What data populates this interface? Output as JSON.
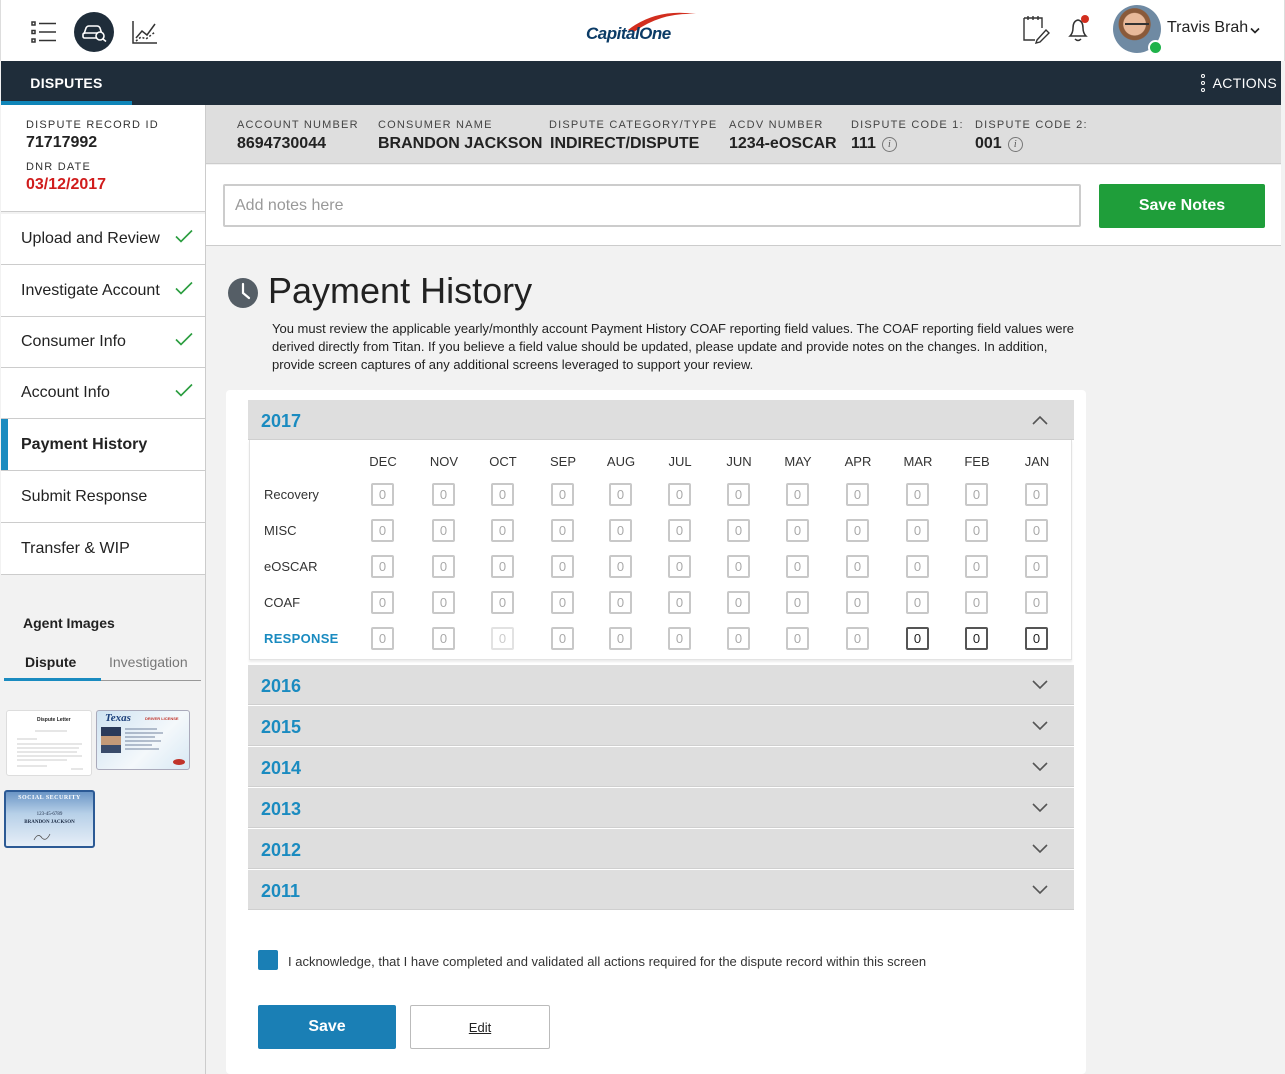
{
  "app": {
    "logo_text": "CapitalOne",
    "user_name": "Travis Brah",
    "nav_tab": "DISPUTES",
    "actions_label": "ACTIONS"
  },
  "record": {
    "id_label": "DISPUTE RECORD ID",
    "id_value": "71717992",
    "dnr_label": "DNR DATE",
    "dnr_value": "03/12/2017"
  },
  "sidebar": {
    "items": [
      {
        "label": "Upload and Review",
        "done": true
      },
      {
        "label": "Investigate Account",
        "done": true
      },
      {
        "label": "Consumer Info",
        "done": true
      },
      {
        "label": "Account Info",
        "done": true
      },
      {
        "label": "Payment History",
        "done": false,
        "active": true
      },
      {
        "label": "Submit Response",
        "done": false
      },
      {
        "label": "Transfer & WIP",
        "done": false
      }
    ],
    "agent_images_title": "Agent Images",
    "image_tabs": [
      "Dispute",
      "Investigation"
    ],
    "thumb_letter_title": "Dispute Letter",
    "thumb_license_title": "Texas",
    "thumb_license_sub": "DRIVER LICENSE",
    "thumb_ssn_title": "SOCIAL SECURITY",
    "thumb_ssn_number": "123-45-6789",
    "thumb_ssn_name": "BRANDON JACKSON"
  },
  "info": {
    "account_number_label": "ACCOUNT NUMBER",
    "account_number": "8694730044",
    "consumer_name_label": "CONSUMER NAME",
    "consumer_name": "BRANDON JACKSON",
    "category_label": "DISPUTE CATEGORY/TYPE",
    "category": "INDIRECT/DISPUTE",
    "acdv_label": "ACDV NUMBER",
    "acdv": "1234-eOSCAR",
    "code1_label": "DISPUTE CODE 1:",
    "code1": "111",
    "code2_label": "DISPUTE CODE 2:",
    "code2": "001",
    "info_glyph": "i"
  },
  "notes": {
    "placeholder": "Add notes here",
    "save_label": "Save Notes"
  },
  "payment_history": {
    "title": "Payment History",
    "description": "You must review the applicable yearly/monthly account Payment History COAF reporting field values. The COAF reporting field values were derived directly from Titan. If you believe a field value should be updated, please update and provide notes on the changes. In addition, provide screen captures of any additional screens leveraged to support your review.",
    "expanded_year": "2017",
    "months": [
      "DEC",
      "NOV",
      "OCT",
      "SEP",
      "AUG",
      "JUL",
      "JUN",
      "MAY",
      "APR",
      "MAR",
      "FEB",
      "JAN"
    ],
    "rows": [
      {
        "label": "Recovery",
        "values": [
          "0",
          "0",
          "0",
          "0",
          "0",
          "0",
          "0",
          "0",
          "0",
          "0",
          "0",
          "0"
        ]
      },
      {
        "label": "MISC",
        "values": [
          "0",
          "0",
          "0",
          "0",
          "0",
          "0",
          "0",
          "0",
          "0",
          "0",
          "0",
          "0"
        ]
      },
      {
        "label": "eOSCAR",
        "values": [
          "0",
          "0",
          "0",
          "0",
          "0",
          "0",
          "0",
          "0",
          "0",
          "0",
          "0",
          "0"
        ]
      },
      {
        "label": "COAF",
        "values": [
          "0",
          "0",
          "0",
          "0",
          "0",
          "0",
          "0",
          "0",
          "0",
          "0",
          "0",
          "0"
        ]
      },
      {
        "label": "RESPONSE",
        "values": [
          "0",
          "0",
          "0",
          "0",
          "0",
          "0",
          "0",
          "0",
          "0",
          "0",
          "0",
          "0"
        ]
      }
    ],
    "collapsed_years": [
      "2016",
      "2015",
      "2014",
      "2013",
      "2012",
      "2011"
    ],
    "acknowledge_text": "I acknowledge, that I have completed and validated all actions required for the dispute record within this screen",
    "save_label": "Save",
    "edit_label": "Edit"
  },
  "colors": {
    "nav_dark": "#1f2d3a",
    "accent_blue": "#1a8bc0",
    "save_green": "#1f9e3a",
    "alert_red": "#d01c1c"
  }
}
